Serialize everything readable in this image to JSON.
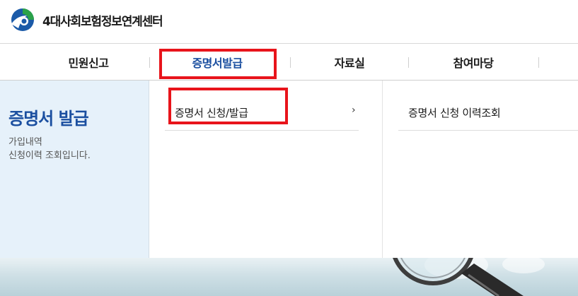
{
  "header": {
    "logo_text": "4대사회보험정보연계센터",
    "colors": {
      "logo_blue": "#1b5aa8",
      "logo_green": "#2ba24a"
    }
  },
  "gnb": {
    "items": [
      {
        "label": "민원신고",
        "active": false
      },
      {
        "label": "증명서발급",
        "active": true
      },
      {
        "label": "자료실",
        "active": false
      },
      {
        "label": "참여마당",
        "active": false
      }
    ],
    "active_color": "#1b4fa0"
  },
  "panel": {
    "title": "증명서 발급",
    "description": [
      "가입내역",
      "신청이력 조회입니다."
    ],
    "menus": [
      {
        "label": "증명서 신청/발급",
        "chevron": "›"
      },
      {
        "label": "증명서 신청 이력조회"
      }
    ]
  },
  "annotations": {
    "highlight_color": "#e8141b"
  },
  "icons": [
    "logo-mark-icon",
    "chevron-right-icon",
    "magnifier-illustration"
  ]
}
